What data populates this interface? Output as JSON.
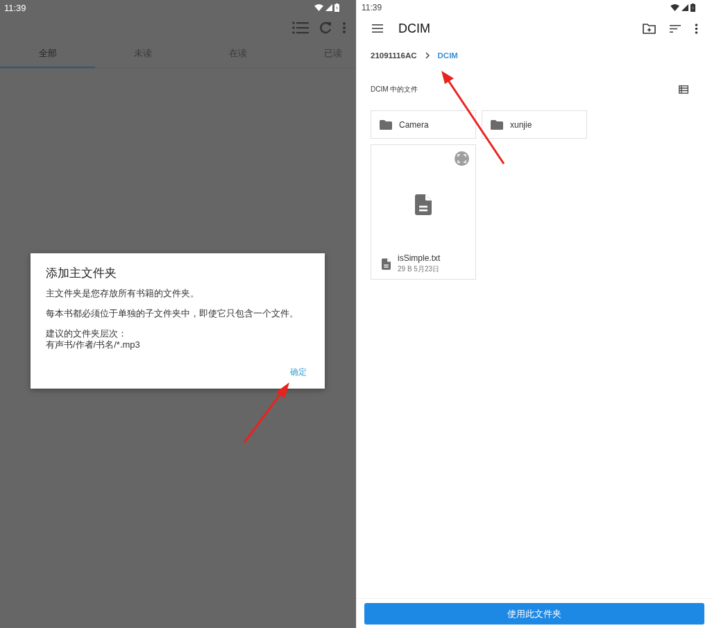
{
  "left_screen": {
    "status_bar": {
      "time": "11:39"
    },
    "tabs": [
      {
        "label": "全部",
        "selected": true
      },
      {
        "label": "未读",
        "selected": false
      },
      {
        "label": "在读",
        "selected": false
      },
      {
        "label": "已读",
        "selected": false
      }
    ],
    "dialog": {
      "title": "添加主文件夹",
      "paragraphs": [
        [
          "主文件夹是您存放所有书籍的文件夹。"
        ],
        [
          "每本书都必须位于单独的子文件夹中，即使它只包含一个文件。"
        ],
        [
          "建议的文件夹层次：",
          "有声书/作者/书名/*.mp3"
        ]
      ],
      "button": "确定"
    }
  },
  "right_screen": {
    "status_bar": {
      "time": "11:39"
    },
    "toolbar": {
      "title": "DCIM"
    },
    "breadcrumb": [
      {
        "label": "21091116AC",
        "current": false
      },
      {
        "label": "DCIM",
        "current": true
      }
    ],
    "section_title": "DCIM 中的文件",
    "items": [
      {
        "kind": "folder",
        "name": "Camera"
      },
      {
        "kind": "folder",
        "name": "xunjie"
      },
      {
        "kind": "file",
        "name": "isSimple.txt",
        "details": "29 B 5月23日"
      }
    ],
    "primary_button": "使用此文件夹"
  }
}
